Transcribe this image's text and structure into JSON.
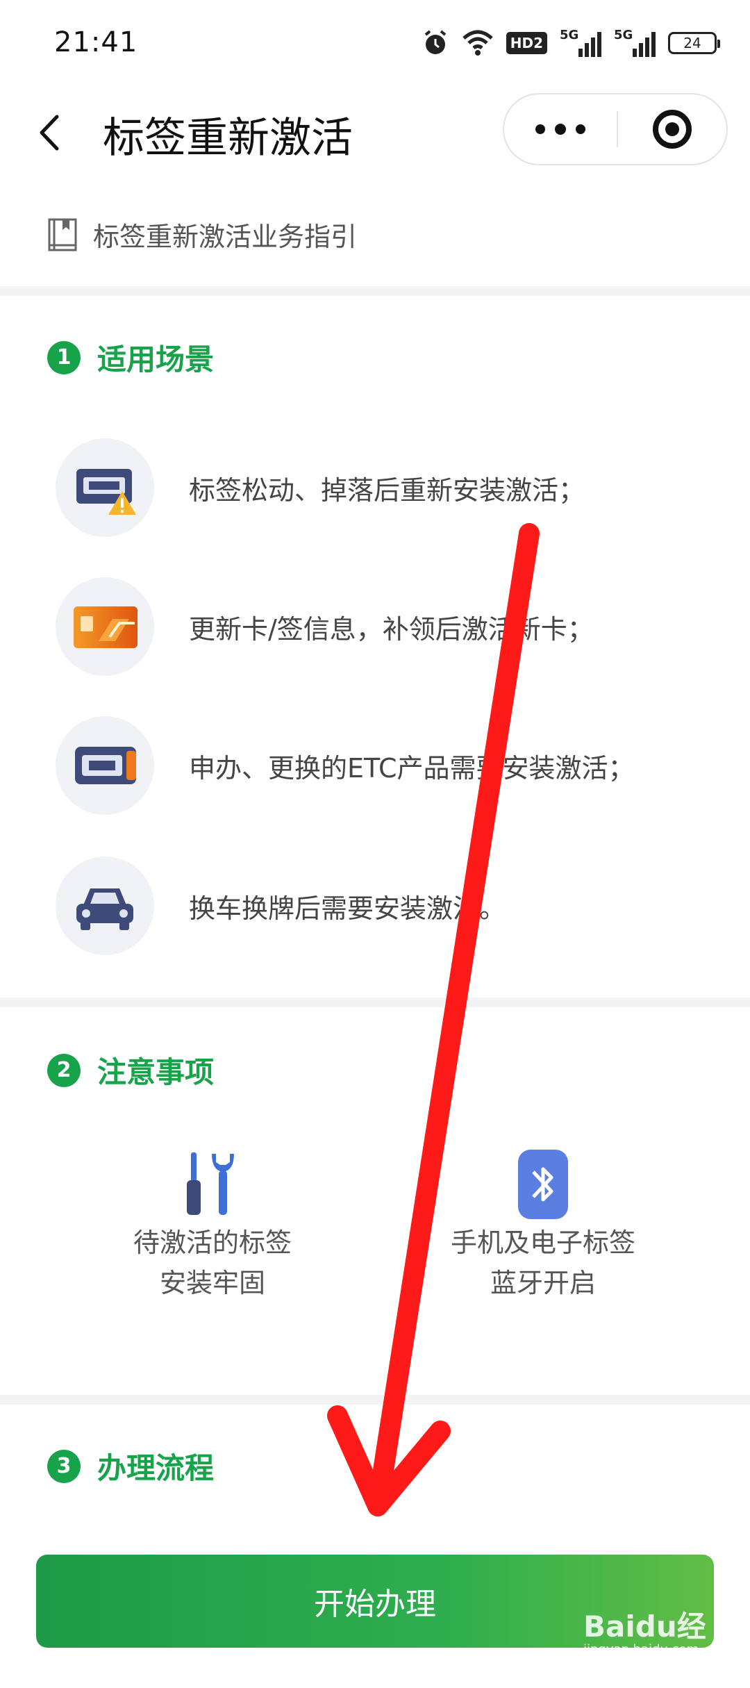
{
  "status_bar": {
    "time": "21:41",
    "hd_label": "HD2",
    "signal_1_label": "5G",
    "signal_2_label": "5G",
    "battery": "24"
  },
  "nav": {
    "title": "标签重新激活"
  },
  "guide": {
    "label": "标签重新激活业务指引"
  },
  "sections": {
    "scenarios": {
      "number": "1",
      "title": "适用场景",
      "items": [
        {
          "text": "标签松动、掉落后重新安装激活；",
          "icon": "loose-tag-warning-icon"
        },
        {
          "text": "更新卡/签信息，补领后激活新卡；",
          "icon": "card-icon"
        },
        {
          "text": "申办、更换的ETC产品需要安装激活；",
          "icon": "etc-device-icon"
        },
        {
          "text": "换车换牌后需要安装激活。",
          "icon": "car-icon"
        }
      ]
    },
    "notices": {
      "number": "2",
      "title": "注意事项",
      "items": [
        {
          "line1": "待激活的标签",
          "line2": "安装牢固",
          "icon": "tools-icon"
        },
        {
          "line1": "手机及电子标签",
          "line2": "蓝牙开启",
          "icon": "bluetooth-icon"
        }
      ]
    },
    "process": {
      "number": "3",
      "title": "办理流程"
    }
  },
  "cta": {
    "label": "开始办理"
  },
  "watermark": {
    "brand": "Baidu经验",
    "sub": "jingyan.baidu.com"
  },
  "colors": {
    "accent_green": "#16a34a",
    "annotation_red": "#ff1a1a",
    "icon_navy": "#3d4a7a",
    "bluetooth_blue": "#5b7fe0"
  }
}
